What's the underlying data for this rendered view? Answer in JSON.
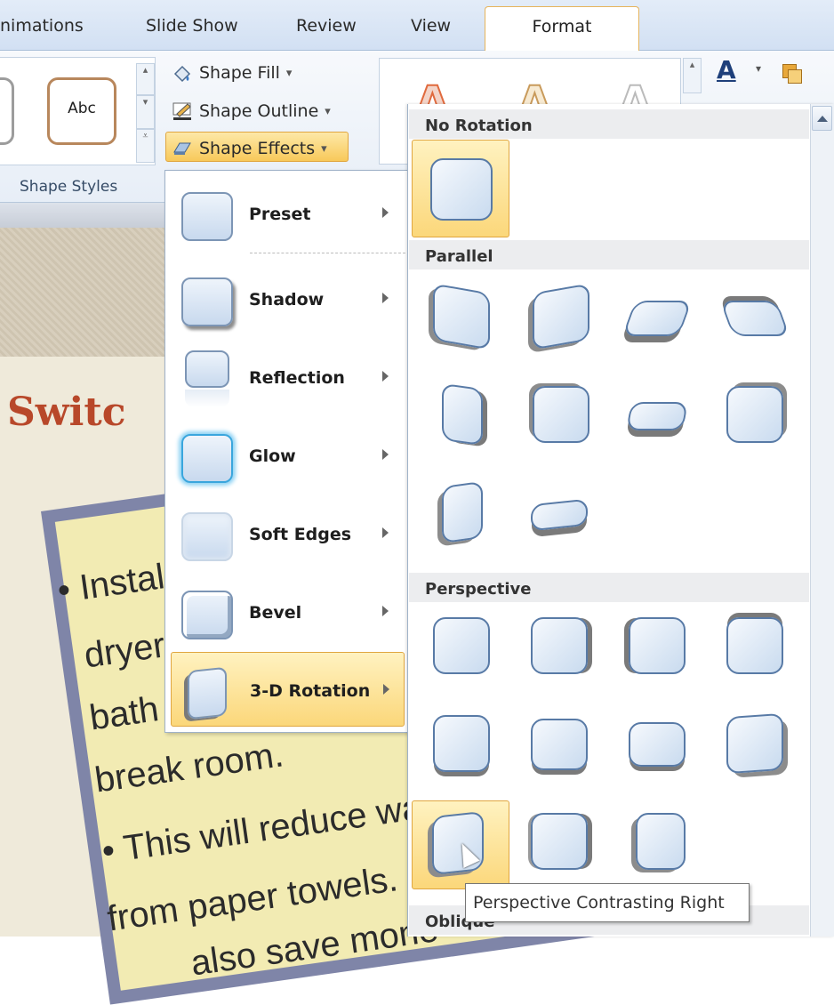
{
  "tabs": [
    "nimations",
    "Slide Show",
    "Review",
    "View",
    "Format"
  ],
  "ribbon": {
    "shape_style_sample": "Abc",
    "shape_fill": "Shape Fill",
    "shape_outline": "Shape Outline",
    "shape_effects": "Shape Effects",
    "group_label": "Shape Styles",
    "dropdown_arrow": "▾"
  },
  "slide": {
    "title": "Switc",
    "lines": [
      "Instal",
      "dryer",
      "bath",
      "break room.",
      "This will reduce waste",
      "from paper towels.",
      "also save mone"
    ]
  },
  "menu": {
    "items": [
      {
        "label": "Preset"
      },
      {
        "label": "Shadow"
      },
      {
        "label": "Reflection"
      },
      {
        "label": "Glow"
      },
      {
        "label": "Soft Edges"
      },
      {
        "label": "Bevel"
      },
      {
        "label": "3-D Rotation"
      }
    ]
  },
  "gallery": {
    "sections": [
      "No Rotation",
      "Parallel",
      "Perspective",
      "Oblique"
    ]
  },
  "tooltip": "Perspective Contrasting Right",
  "colors": {
    "accent": "#f8c95a",
    "title": "#b8482a"
  }
}
